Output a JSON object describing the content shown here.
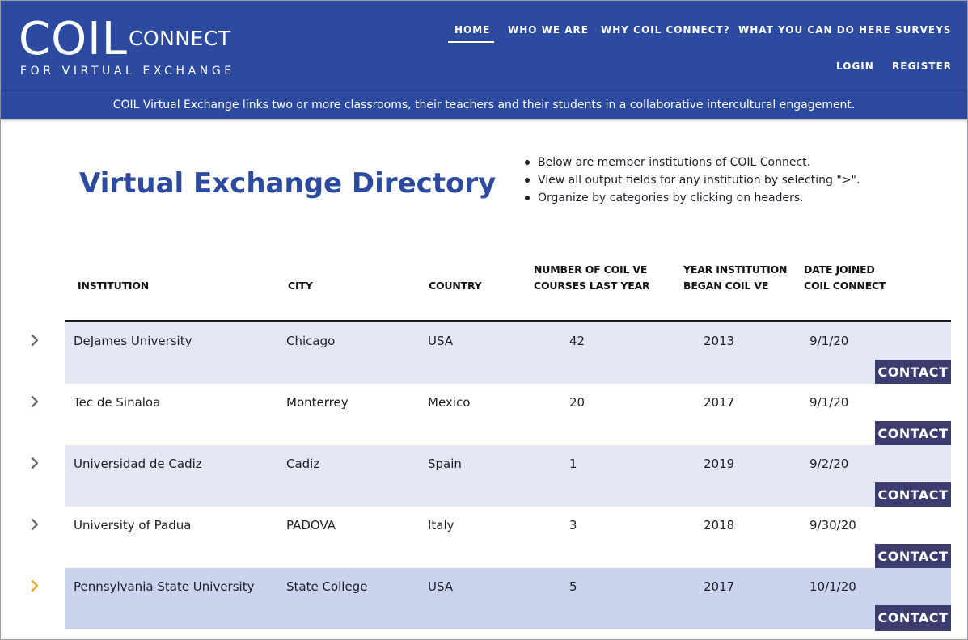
{
  "header": {
    "logo": {
      "main": "COIL",
      "secondary": "CONNECT",
      "tagline": "FOR VIRTUAL EXCHANGE"
    },
    "nav": [
      {
        "label": "HOME",
        "active": true
      },
      {
        "label": "WHO WE ARE"
      },
      {
        "label": "WHY COIL CONNECT?"
      },
      {
        "label": "WHAT YOU CAN DO HERE"
      },
      {
        "label": "SURVEYS"
      },
      {
        "label": "LOGIN"
      },
      {
        "label": "REGISTER"
      }
    ],
    "color": "#2c4a9f"
  },
  "banner": {
    "text": "COIL Virtual Exchange links two or more classrooms, their teachers and their students in a collaborative intercultural engagement."
  },
  "page": {
    "title": "Virtual Exchange Directory",
    "notes": [
      "Below are member institutions of COIL Connect.",
      "View all output fields for any institution by selecting \">\".",
      "Organize by categories by clicking on headers."
    ]
  },
  "table": {
    "headers": [
      {
        "lines": [
          "INSTITUTION"
        ]
      },
      {
        "lines": [
          "CITY"
        ]
      },
      {
        "lines": [
          "COUNTRY"
        ]
      },
      {
        "lines": [
          "NUMBER OF COIL VE",
          "COURSES LAST YEAR"
        ]
      },
      {
        "lines": [
          "YEAR INSTITUTION",
          "BEGAN COIL VE"
        ]
      },
      {
        "lines": [
          "DATE JOINED",
          "COIL CONNECT"
        ]
      }
    ],
    "contact_label": "CONTACT",
    "expander_icon": "chevron-right-icon",
    "colors": {
      "row_shaded": "#e4e8f6",
      "row_plain": "#ffffff",
      "row_highlighted": "#ccd3ee",
      "chevron": "#6e6e6e",
      "chevron_active": "#f5a623",
      "contact_button": "#3d3c6e"
    },
    "rows": [
      {
        "institution": "DeJames University",
        "city": "Chicago",
        "country": "USA",
        "courses": "42",
        "year_began": "2013",
        "date_joined": "9/1/20"
      },
      {
        "institution": "Tec de Sinaloa",
        "city": "Monterrey",
        "country": "Mexico",
        "courses": "20",
        "year_began": "2017",
        "date_joined": "9/1/20"
      },
      {
        "institution": "Universidad de Cadiz",
        "city": "Cadiz",
        "country": "Spain",
        "courses": "1",
        "year_began": "2019",
        "date_joined": "9/2/20"
      },
      {
        "institution": "University of Padua",
        "city": "PADOVA",
        "country": "Italy",
        "courses": "3",
        "year_began": "2018",
        "date_joined": "9/30/20"
      },
      {
        "institution": "Pennsylvania State University",
        "city": "State College",
        "country": "USA",
        "courses": "5",
        "year_began": "2017",
        "date_joined": "10/1/20",
        "hovered": true
      }
    ]
  }
}
